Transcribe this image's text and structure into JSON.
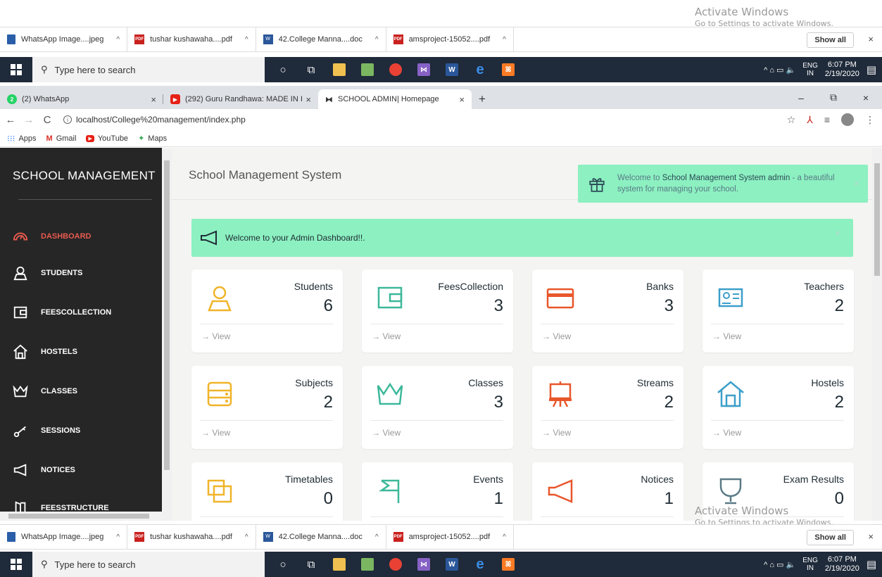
{
  "watermark": {
    "title": "Activate Windows",
    "subtitle": "Go to Settings to activate Windows."
  },
  "downloads": {
    "items": [
      {
        "name": "WhatsApp Image....jpeg",
        "icon": "image-file-icon"
      },
      {
        "name": "tushar kushawaha....pdf",
        "icon": "pdf-file-icon"
      },
      {
        "name": "42.College Manna....doc",
        "icon": "word-file-icon"
      },
      {
        "name": "amsproject-15052....pdf",
        "icon": "pdf-file-icon"
      }
    ],
    "show_all": "Show all",
    "close": "×"
  },
  "taskbar": {
    "search_placeholder": "Type here to search",
    "lang_line1": "ENG",
    "lang_line2": "IN",
    "time": "6:07 PM",
    "date": "2/19/2020"
  },
  "browser": {
    "tabs": [
      {
        "label": "(2) WhatsApp",
        "badge": "2",
        "color": "#25d366"
      },
      {
        "label": "(292) Guru Randhawa: MADE IN I",
        "badge": "▶",
        "color": "#e62117"
      },
      {
        "label": "SCHOOL ADMIN| Homepage",
        "badge": "⧓",
        "color": "#222222"
      }
    ],
    "new_tab": "+",
    "url": "localhost/College%20management/index.php",
    "bookmarks": [
      {
        "label": "Apps"
      },
      {
        "label": "Gmail"
      },
      {
        "label": "YouTube"
      },
      {
        "label": "Maps"
      }
    ]
  },
  "sidebar": {
    "brand": "SCHOOL MANAGEMENT",
    "items": [
      {
        "label": "DASHBOARD",
        "icon": "dashboard-gauge-icon",
        "active": true
      },
      {
        "label": "STUDENTS",
        "icon": "student-icon"
      },
      {
        "label": "FEESCOLLECTION",
        "icon": "wallet-icon"
      },
      {
        "label": "HOSTELS",
        "icon": "home-icon"
      },
      {
        "label": "CLASSES",
        "icon": "crown-icon"
      },
      {
        "label": "SESSIONS",
        "icon": "key-icon"
      },
      {
        "label": "NOTICES",
        "icon": "megaphone-icon"
      },
      {
        "label": "FEESSTRUCTURE",
        "icon": "door-icon"
      }
    ]
  },
  "main": {
    "title": "School Management System",
    "toast": {
      "prefix": "Welcome to ",
      "bold": "School Management System admin",
      "suffix": " - a beautiful system for managing your school."
    },
    "banner": "Welcome to your Admin Dashboard!!.",
    "view_label": "→ View",
    "cards": [
      {
        "label": "Students",
        "value": "6",
        "icon": "student-icon",
        "color": "#f0b429"
      },
      {
        "label": "FeesCollection",
        "value": "3",
        "icon": "wallet-icon",
        "color": "#3cb89a"
      },
      {
        "label": "Banks",
        "value": "3",
        "icon": "credit-card-icon",
        "color": "#e8562a"
      },
      {
        "label": "Teachers",
        "value": "2",
        "icon": "id-card-icon",
        "color": "#3c9fc9"
      },
      {
        "label": "Subjects",
        "value": "2",
        "icon": "server-icon",
        "color": "#f0b429"
      },
      {
        "label": "Classes",
        "value": "3",
        "icon": "crown-icon",
        "color": "#3cb89a"
      },
      {
        "label": "Streams",
        "value": "2",
        "icon": "presentation-board-icon",
        "color": "#e8562a"
      },
      {
        "label": "Hostels",
        "value": "2",
        "icon": "home-icon",
        "color": "#3c9fc9"
      },
      {
        "label": "Timetables",
        "value": "0",
        "icon": "copy-icon",
        "color": "#f0b429"
      },
      {
        "label": "Events",
        "value": "1",
        "icon": "flag-icon",
        "color": "#3cb89a"
      },
      {
        "label": "Notices",
        "value": "1",
        "icon": "megaphone-icon",
        "color": "#e8562a"
      },
      {
        "label": "Exam Results",
        "value": "0",
        "icon": "trophy-icon",
        "color": "#5a7a86"
      }
    ]
  }
}
